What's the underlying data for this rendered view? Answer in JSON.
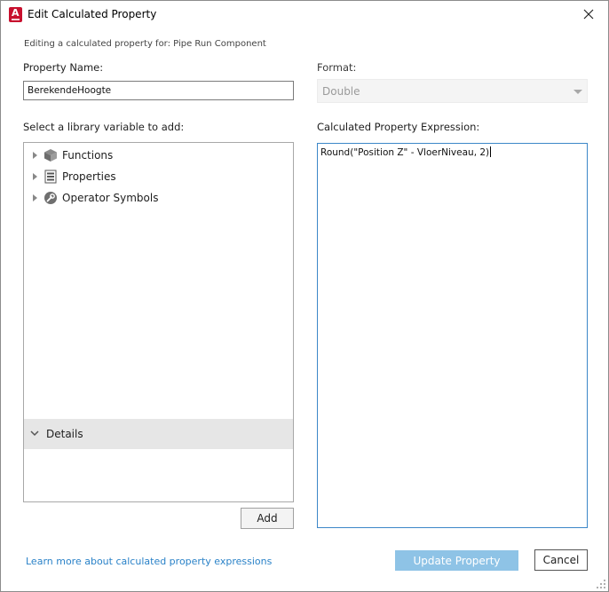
{
  "window": {
    "title": "Edit Calculated Property",
    "app_icon_letter": "A",
    "close_icon": "close-icon"
  },
  "subtitle": "Editing a calculated property for: Pipe Run Component",
  "property_name": {
    "label": "Property Name:",
    "value": "BerekendeHoogte"
  },
  "format": {
    "label": "Format:",
    "value": "Double"
  },
  "library": {
    "label": "Select a library variable to add:",
    "items": [
      {
        "label": "Functions",
        "icon": "cube-icon"
      },
      {
        "label": "Properties",
        "icon": "properties-list-icon"
      },
      {
        "label": "Operator Symbols",
        "icon": "operator-wrench-icon"
      }
    ],
    "details_label": "Details",
    "add_label": "Add"
  },
  "expression": {
    "label": "Calculated Property Expression:",
    "value": "Round(\"Position Z\" - VloerNiveau, 2)"
  },
  "footer": {
    "learn_more": "Learn more about calculated property expressions",
    "update_label": "Update Property",
    "cancel_label": "Cancel"
  },
  "colors": {
    "accent": "#3c87c8",
    "link": "#2a82c8",
    "update_button": "#8ec3e6",
    "app_icon": "#c8102e"
  }
}
